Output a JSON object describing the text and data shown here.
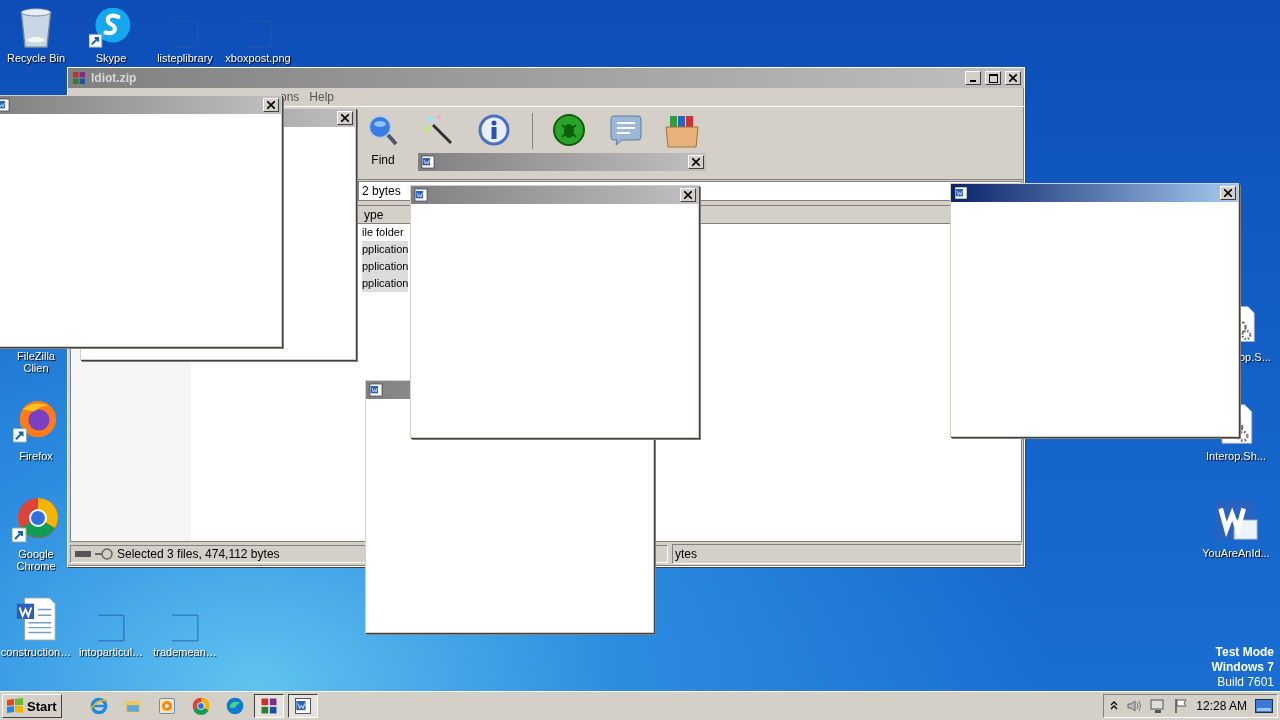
{
  "desktop_icons": [
    {
      "label": "Recycle Bin",
      "kind": "recycle"
    },
    {
      "label": "Skype",
      "kind": "skype"
    },
    {
      "label": "listeplibrary",
      "kind": "blank"
    },
    {
      "label": "xboxpost.png",
      "kind": "blank"
    },
    {
      "label": "FileZilla Clien",
      "kind": "covered"
    },
    {
      "label": "Firefox",
      "kind": "firefox"
    },
    {
      "label": "Google Chrome",
      "kind": "chrome"
    },
    {
      "label": "construction…",
      "kind": "word-doc"
    },
    {
      "label": "intoparticul…",
      "kind": "blank"
    },
    {
      "label": "trademean…",
      "kind": "blank"
    },
    {
      "label": "op.S...",
      "kind": "script"
    },
    {
      "label": "Interop.Sh...",
      "kind": "script"
    },
    {
      "label": "YouAreAnId...",
      "kind": "word"
    }
  ],
  "archive_window": {
    "title": "Idiot.zip",
    "menu": [
      "ons",
      "Help"
    ],
    "toolbar": [
      {
        "kind": "find",
        "label": "Find"
      },
      {
        "kind": "wizard"
      },
      {
        "kind": "info"
      },
      {
        "kind": "virus-scan"
      },
      {
        "kind": "comment"
      },
      {
        "kind": "sfx"
      }
    ],
    "address": "2 bytes",
    "column": "ype",
    "rows": [
      {
        "type": "ile folder",
        "selected": false
      },
      {
        "type": "pplication",
        "selected": true
      },
      {
        "type": "pplication",
        "selected": true
      },
      {
        "type": "pplication",
        "selected": true
      }
    ],
    "status": "Selected 3 files, 474,112 bytes",
    "status_right": "ytes"
  },
  "popups": [
    {
      "active": false
    },
    {
      "active": false
    },
    {
      "active": false
    },
    {
      "active": false
    },
    {
      "active": false
    },
    {
      "active": true
    }
  ],
  "taskbar": {
    "start": "Start",
    "apps": [
      {
        "kind": "ie",
        "pressed": false
      },
      {
        "kind": "explorer",
        "pressed": false
      },
      {
        "kind": "media",
        "pressed": false
      },
      {
        "kind": "chrome",
        "pressed": false
      },
      {
        "kind": "edge",
        "pressed": false
      },
      {
        "kind": "winrar",
        "pressed": true
      },
      {
        "kind": "word",
        "pressed": true
      }
    ],
    "clock": "12:28 AM"
  },
  "os_notice": [
    "Test Mode",
    "Windows 7",
    "Build 7601"
  ]
}
